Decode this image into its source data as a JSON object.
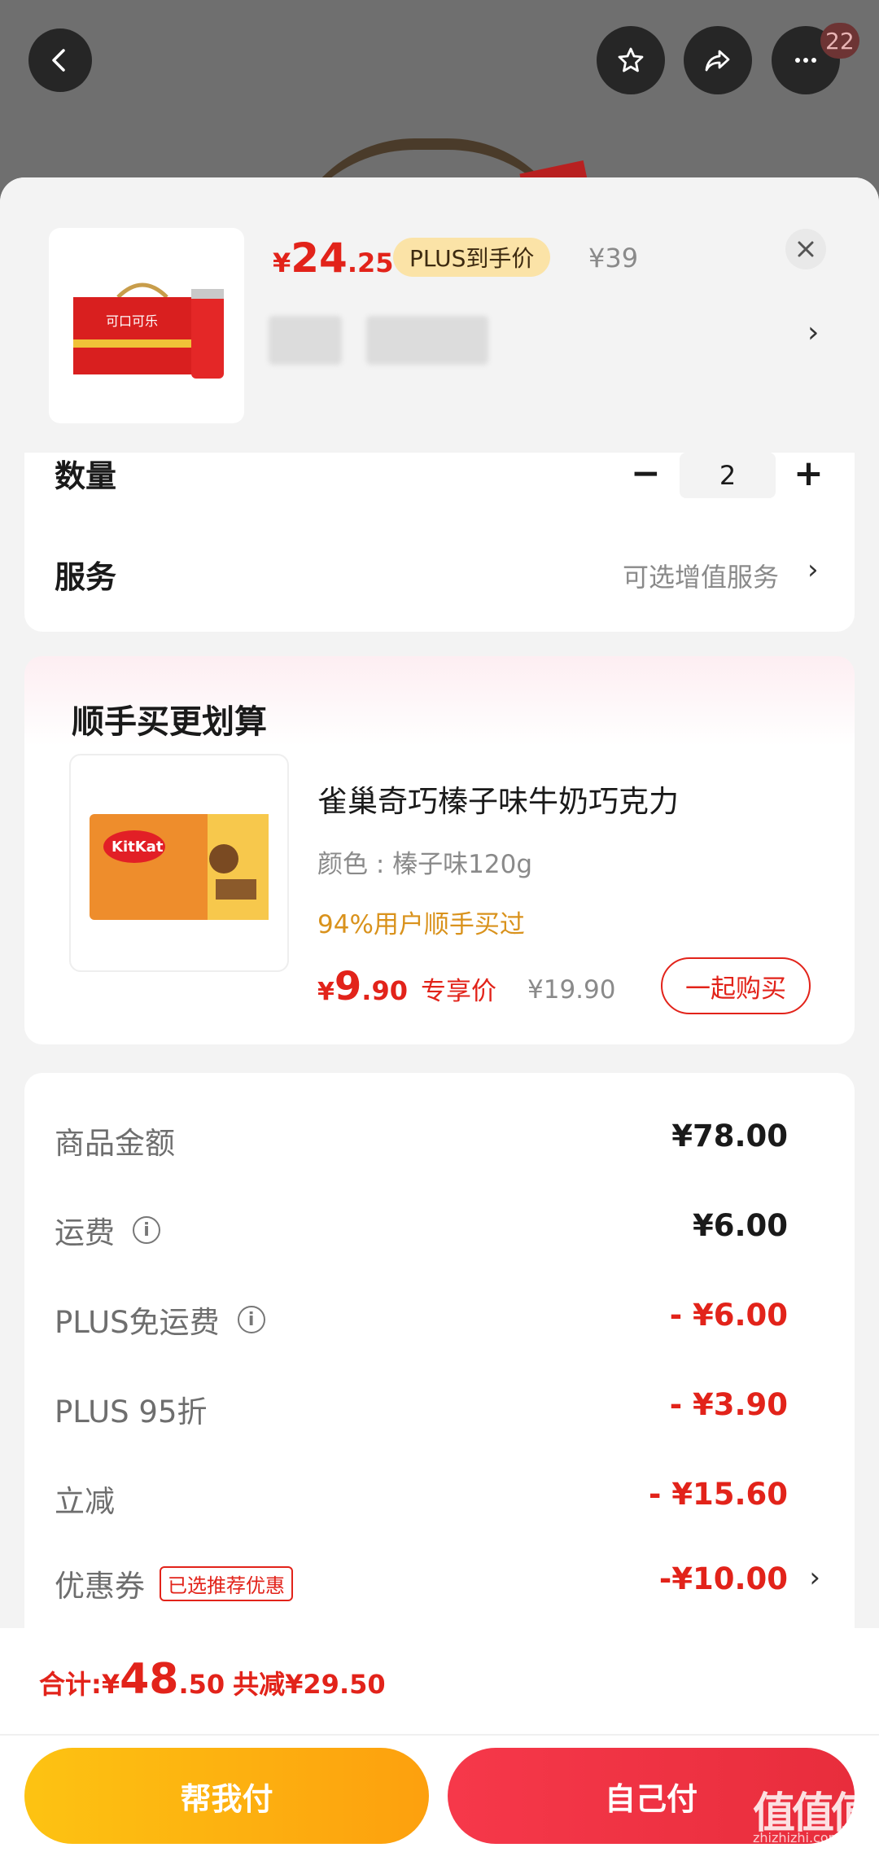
{
  "header": {
    "badge_count": "22"
  },
  "product": {
    "price_yen": "¥",
    "price_int": "24",
    "price_dec": ".25",
    "plus_tag": "PLUS到手价",
    "orig_price": "¥39"
  },
  "quantity": {
    "label": "数量",
    "minus": "−",
    "value": "2",
    "plus": "+"
  },
  "service": {
    "label": "服务",
    "value": "可选增值服务",
    "arrow": "›"
  },
  "bundle": {
    "title": "顺手买更划算",
    "name": "雀巢奇巧榛子味牛奶巧克力",
    "color": "颜色 : 榛子味120g",
    "percent": "94%用户顺手买过",
    "price_yen": "¥",
    "price_int": "9",
    "price_dec": ".90",
    "price_tag": "专享价",
    "orig_price": "¥19.90",
    "buy_button": "一起购买"
  },
  "fees": [
    {
      "label": "商品金额",
      "value": "¥78.00"
    },
    {
      "label": "运费",
      "value": "¥6.00"
    },
    {
      "label": "PLUS免运费",
      "value": "- ¥6.00"
    },
    {
      "label": "PLUS 95折",
      "value": "- ¥3.90"
    },
    {
      "label": "立减",
      "value": "- ¥15.60"
    },
    {
      "label": "优惠券",
      "tag": "已选推荐优惠",
      "value": "-¥10.00"
    }
  ],
  "total": {
    "label": "合计: ",
    "yen": "¥",
    "int": "48",
    "dec": ".50",
    "save": "共减¥29.50"
  },
  "buttons": {
    "pay_friend": "帮我付",
    "pay_self": "自己付"
  },
  "watermark": {
    "text": "值值值",
    "url": "zhizhizhi.com"
  },
  "colors": {
    "accent_red": "#e2231a",
    "gold": "#d9921c",
    "pay_friend": "#fdb410",
    "pay_self": "#f0333f"
  }
}
